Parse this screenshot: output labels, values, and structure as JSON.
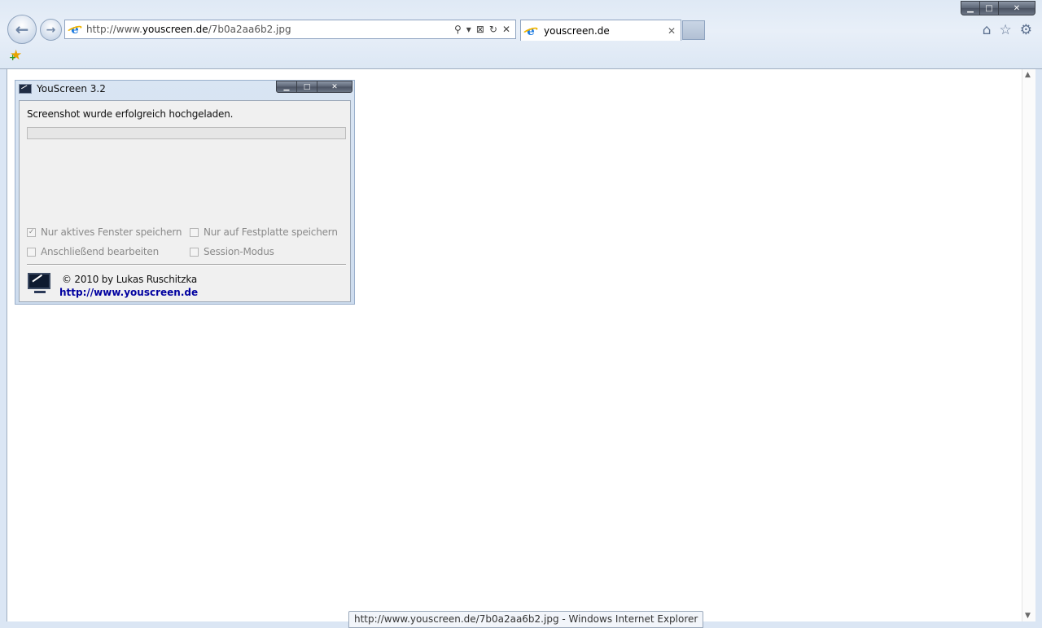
{
  "browser": {
    "url_prefix": "http://www.",
    "url_domain": "youscreen.de",
    "url_path": "/7b0a2aa6b2.jpg",
    "tab_title": "youscreen.de",
    "status_tooltip": "http://www.youscreen.de/7b0a2aa6b2.jpg - Windows Internet Explorer",
    "icons": {
      "back": "back-arrow-icon",
      "forward": "forward-arrow-icon",
      "search": "search-icon",
      "compat": "compatibility-view-icon",
      "refresh": "refresh-icon",
      "stop": "stop-icon",
      "home": "home-icon",
      "favorites": "star-icon",
      "tools": "gear-icon",
      "add_favorites": "add-favorites-icon"
    },
    "glyphs": {
      "back": "←",
      "forward": "→",
      "search": "⚲",
      "dropdown": "▾",
      "compat": "⊠",
      "refresh": "↻",
      "stop": "✕",
      "tab_close": "✕",
      "home": "⌂",
      "star": "☆",
      "gear": "⚙",
      "fav_star": "★",
      "fav_plus": "+",
      "minimize": "▁",
      "maximize": "□",
      "close": "✕",
      "scroll_up": "▲",
      "scroll_down": "▼"
    }
  },
  "youscreen": {
    "title": "YouScreen 3.2",
    "message": "Screenshot wurde erfolgreich hochgeladen.",
    "progress": 0,
    "options": [
      {
        "label": "Nur aktives Fenster speichern",
        "checked": true,
        "check_glyph": "✓"
      },
      {
        "label": "Nur auf Festplatte speichern",
        "checked": false,
        "check_glyph": ""
      },
      {
        "label": "Anschließend bearbeiten",
        "checked": false,
        "check_glyph": ""
      },
      {
        "label": "Session-Modus",
        "checked": false,
        "check_glyph": ""
      }
    ],
    "copyright": "© 2010 by Lukas Ruschitzka",
    "link": "http://www.youscreen.de",
    "colors": {
      "link": "#0000a0",
      "progress_fill": "#06b025"
    }
  }
}
